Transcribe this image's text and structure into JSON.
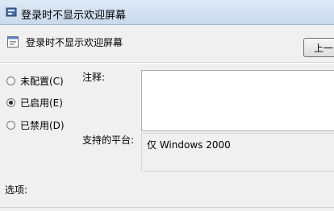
{
  "window": {
    "title": "登录时不显示欢迎屏幕",
    "icon": "policy-icon"
  },
  "header": {
    "title": "登录时不显示欢迎屏幕",
    "icon": "policy-settings-icon",
    "prev_button_label": "上一"
  },
  "state_options": [
    {
      "label": "未配置(C)",
      "checked": false
    },
    {
      "label": "已启用(E)",
      "checked": true
    },
    {
      "label": "已禁用(D)",
      "checked": false
    }
  ],
  "comment": {
    "label": "注释:",
    "value": ""
  },
  "supported_on": {
    "label": "支持的平台:",
    "value": "仅 Windows 2000"
  },
  "options": {
    "label": "选项:"
  },
  "colors": {
    "titlebar": "#c9d9ec",
    "background": "#f0f0f0"
  }
}
